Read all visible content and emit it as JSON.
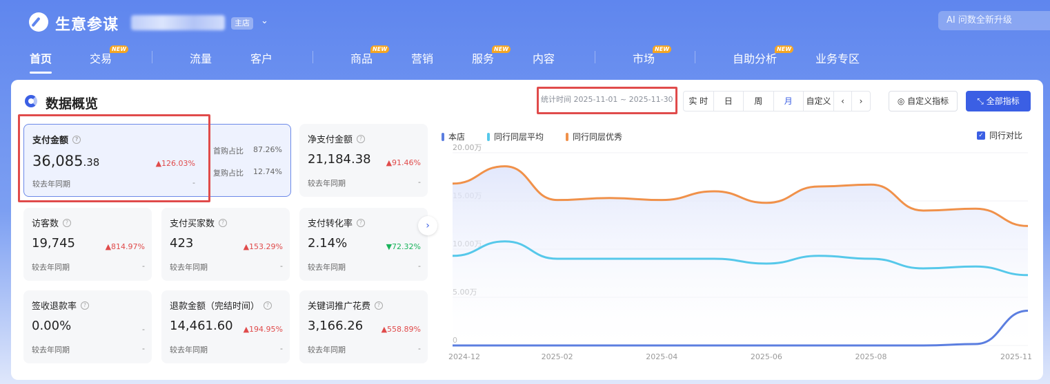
{
  "app": {
    "brand": "生意参谋",
    "shop_badge": "主店",
    "ai_label": "AI 问数全新升级"
  },
  "nav": [
    {
      "label": "首页",
      "new": false,
      "active": true
    },
    {
      "label": "交易",
      "new": true
    },
    {
      "label": "流量",
      "new": false
    },
    {
      "label": "客户",
      "new": false
    },
    {
      "label": "商品",
      "new": true
    },
    {
      "label": "营销",
      "new": false
    },
    {
      "label": "服务",
      "new": true
    },
    {
      "label": "内容",
      "new": false
    },
    {
      "label": "市场",
      "new": true
    },
    {
      "label": "自助分析",
      "new": true
    },
    {
      "label": "业务专区",
      "new": false
    }
  ],
  "new_badge": "NEW",
  "panel": {
    "title": "数据概览",
    "time_range": "统计时间 2025-11-01 ~ 2025-11-30",
    "periods": [
      "实 时",
      "日",
      "周",
      "月",
      "自定义"
    ],
    "active_period": "月",
    "custom_metrics": "自定义指标",
    "all_metrics": "全部指标"
  },
  "cards": {
    "pay": {
      "label": "支付金额",
      "value_int": "36,085",
      "value_dec": ".38",
      "change": "▲126.03%",
      "compare": "较去年同期",
      "dash": "-",
      "first_label": "首购占比",
      "first_value": "87.26%",
      "repeat_label": "复购占比",
      "repeat_value": "12.74%"
    },
    "net_pay": {
      "label": "净支付金额",
      "value": "21,184.38",
      "change": "▲91.46%",
      "compare": "较去年同期",
      "dash": "-"
    },
    "visitors": {
      "label": "访客数",
      "value": "19,745",
      "change": "▲814.97%",
      "compare": "较去年同期",
      "dash": "-"
    },
    "buyers": {
      "label": "支付买家数",
      "value": "423",
      "change": "▲153.29%",
      "compare": "较去年同期",
      "dash": "-"
    },
    "conversion": {
      "label": "支付转化率",
      "value": "2.14%",
      "change": "▼72.32%",
      "compare": "较去年同期",
      "dash": "-"
    },
    "refund_rate": {
      "label": "签收退款率",
      "value": "0.00%",
      "change": "-",
      "compare": "较去年同期",
      "dash": "-"
    },
    "refund_amount": {
      "label": "退款金额（完结时间）",
      "value": "14,461.60",
      "change": "▲194.95%",
      "compare": "较去年同期",
      "dash": "-"
    },
    "keyword_cost": {
      "label": "关键词推广花费",
      "value": "3,166.26",
      "change": "▲558.89%",
      "compare": "较去年同期",
      "dash": "-"
    }
  },
  "colors": {
    "accent": "#3b5fe4",
    "up": "#e04b4b",
    "down": "#19b35b",
    "store": "#5b7ee0",
    "peer_avg": "#56c8ea",
    "peer_top": "#f0914a"
  },
  "chart_data": {
    "type": "line",
    "x": [
      "2024-12",
      "2025-01",
      "2025-02",
      "2025-03",
      "2025-04",
      "2025-05",
      "2025-06",
      "2025-07",
      "2025-08",
      "2025-09",
      "2025-10",
      "2025-11"
    ],
    "xticks": [
      "2024-12",
      "2025-02",
      "2025-04",
      "2025-06",
      "2025-08",
      "2025-11"
    ],
    "yticks": [
      "0",
      "5.00万",
      "10.00万",
      "15.00万",
      "20.00万"
    ],
    "ylim": [
      0,
      200000
    ],
    "series": [
      {
        "name": "本店",
        "values": [
          0,
          0,
          0,
          0,
          0,
          0,
          0,
          0,
          0,
          0,
          1500,
          36085
        ]
      },
      {
        "name": "同行同层平均",
        "values": [
          93000,
          108000,
          90000,
          90000,
          90000,
          90000,
          85000,
          93000,
          90000,
          80000,
          82000,
          73000
        ]
      },
      {
        "name": "同行同层优秀",
        "values": [
          168000,
          186000,
          151000,
          153000,
          151000,
          160000,
          148000,
          165000,
          167000,
          140000,
          142000,
          124000
        ]
      }
    ],
    "legend_position": "top-left",
    "compare_label": "同行对比"
  }
}
